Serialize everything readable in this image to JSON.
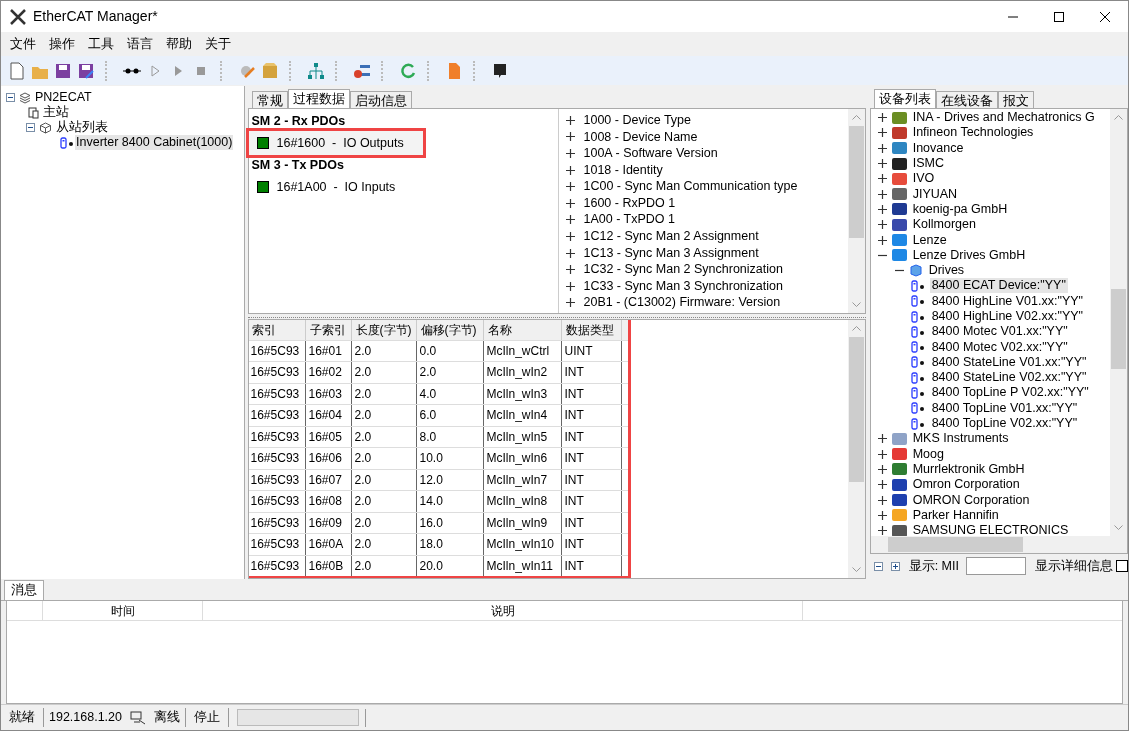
{
  "window": {
    "title": "EtherCAT Manager*"
  },
  "menu": [
    "文件",
    "操作",
    "工具",
    "语言",
    "帮助",
    "关于"
  ],
  "project_tree": {
    "label": "PN2ECAT",
    "expanded": true,
    "children": [
      {
        "label": "主站",
        "kind": "master"
      },
      {
        "label": "从站列表",
        "kind": "slaves",
        "expanded": true,
        "children": [
          {
            "label": "Inverter 8400 Cabinet(1000)",
            "kind": "device",
            "selected": true
          }
        ]
      }
    ]
  },
  "config_tabs": [
    {
      "label": "常规",
      "selected": false
    },
    {
      "label": "过程数据",
      "selected": true
    },
    {
      "label": "启动信息",
      "selected": false
    }
  ],
  "sync_managers": [
    {
      "title": "SM 2 - Rx PDOs",
      "pdos": [
        {
          "label": "16#1600  -  IO Outputs",
          "color": "#008000",
          "selected": true,
          "highlighted": true
        }
      ]
    },
    {
      "title": "SM 3 - Tx PDOs",
      "pdos": [
        {
          "label": "16#1A00  -  IO Inputs",
          "color": "#008000",
          "selected": false,
          "highlighted": false
        }
      ]
    }
  ],
  "objects": [
    "1000 - Device Type",
    "1008 - Device Name",
    "100A - Software Version",
    "1018 - Identity",
    "1C00 - Sync Man Communication type",
    "1600 - RxPDO 1",
    "1A00 - TxPDO 1",
    "1C12 - Sync Man 2 Assignment",
    "1C13 - Sync Man 3 Assignment",
    "1C32 - Sync Man 2 Synchronization",
    "1C33 - Sync Man 3 Synchronization",
    "20B1 - (C13002) Firmware: Version"
  ],
  "pdo_table": {
    "highlighted": true,
    "columns": [
      "索引",
      "子索引",
      "长度(字节)",
      "偏移(字节)",
      "名称",
      "数据类型"
    ],
    "rows": [
      [
        "16#5C93",
        "16#01",
        "2.0",
        "0.0",
        "McIln_wCtrl",
        "UINT"
      ],
      [
        "16#5C93",
        "16#02",
        "2.0",
        "2.0",
        "McIln_wIn2",
        "INT"
      ],
      [
        "16#5C93",
        "16#03",
        "2.0",
        "4.0",
        "McIln_wIn3",
        "INT"
      ],
      [
        "16#5C93",
        "16#04",
        "2.0",
        "6.0",
        "McIln_wIn4",
        "INT"
      ],
      [
        "16#5C93",
        "16#05",
        "2.0",
        "8.0",
        "McIln_wIn5",
        "INT"
      ],
      [
        "16#5C93",
        "16#06",
        "2.0",
        "10.0",
        "McIln_wIn6",
        "INT"
      ],
      [
        "16#5C93",
        "16#07",
        "2.0",
        "12.0",
        "McIln_wIn7",
        "INT"
      ],
      [
        "16#5C93",
        "16#08",
        "2.0",
        "14.0",
        "McIln_wIn8",
        "INT"
      ],
      [
        "16#5C93",
        "16#09",
        "2.0",
        "16.0",
        "McIln_wIn9",
        "INT"
      ],
      [
        "16#5C93",
        "16#0A",
        "2.0",
        "18.0",
        "McIln_wIn10",
        "INT"
      ],
      [
        "16#5C93",
        "16#0B",
        "2.0",
        "20.0",
        "McIln_wIn11",
        "INT"
      ]
    ]
  },
  "library_tabs": [
    {
      "label": "设备列表",
      "selected": true
    },
    {
      "label": "在线设备",
      "selected": false
    },
    {
      "label": "报文",
      "selected": false
    }
  ],
  "device_library": [
    {
      "label": "INA - Drives and Mechatronics G",
      "color": "#6b8e23",
      "expanded": false
    },
    {
      "label": "Infineon Technologies",
      "color": "#c0392b",
      "expanded": false
    },
    {
      "label": "Inovance",
      "color": "#2e86c1",
      "expanded": false
    },
    {
      "label": "ISMC",
      "color": "#222222",
      "expanded": false
    },
    {
      "label": "IVO",
      "color": "#e74c3c",
      "expanded": false
    },
    {
      "label": "JIYUAN",
      "color": "#666666",
      "expanded": false
    },
    {
      "label": "koenig-pa GmbH",
      "color": "#1f3a93",
      "expanded": false
    },
    {
      "label": "Kollmorgen",
      "color": "#3949ab",
      "expanded": false
    },
    {
      "label": "Lenze",
      "color": "#1e88e5",
      "expanded": false
    },
    {
      "label": "Lenze Drives GmbH",
      "color": "#1e88e5",
      "expanded": true,
      "children": [
        {
          "label": "Drives",
          "expanded": true,
          "children": [
            {
              "label": "8400 ECAT Device:\"YY\"",
              "selected": true
            },
            {
              "label": "8400 HighLine V01.xx:\"YY\"",
              "selected": false
            },
            {
              "label": "8400 HighLine V02.xx:\"YY\"",
              "selected": false
            },
            {
              "label": "8400 Motec V01.xx:\"YY\"",
              "selected": false
            },
            {
              "label": "8400 Motec V02.xx:\"YY\"",
              "selected": false
            },
            {
              "label": "8400 StateLine V01.xx:\"YY\"",
              "selected": false
            },
            {
              "label": "8400 StateLine V02.xx:\"YY\"",
              "selected": false
            },
            {
              "label": "8400 TopLine P V02.xx:\"YY\"",
              "selected": false
            },
            {
              "label": "8400 TopLine V01.xx:\"YY\"",
              "selected": false
            },
            {
              "label": "8400 TopLine V02.xx:\"YY\"",
              "selected": false
            }
          ]
        }
      ]
    },
    {
      "label": "MKS Instruments",
      "color": "#8fa3c7",
      "expanded": false
    },
    {
      "label": "Moog",
      "color": "#e53935",
      "expanded": false
    },
    {
      "label": "Murrlektronik GmbH",
      "color": "#2e7d32",
      "expanded": false
    },
    {
      "label": "Omron Corporation",
      "color": "#1e40af",
      "expanded": false
    },
    {
      "label": "OMRON Corporation",
      "color": "#1e40af",
      "expanded": false
    },
    {
      "label": "Parker Hannifin",
      "color": "#f5a623",
      "expanded": false
    },
    {
      "label": "SAMSUNG ELECTRONICS",
      "color": "#555555",
      "expanded": false
    }
  ],
  "library_footer": {
    "filter_label": "显示: MII",
    "detail_label": "显示详细信息",
    "detail_checked": false
  },
  "messages": {
    "tab": "消息",
    "columns": [
      "时间",
      "说明"
    ]
  },
  "status_bar": {
    "state": "就绪",
    "ip": "192.168.1.20",
    "connection": "离线",
    "run_state": "停止",
    "progress": {
      "level": 0
    }
  }
}
